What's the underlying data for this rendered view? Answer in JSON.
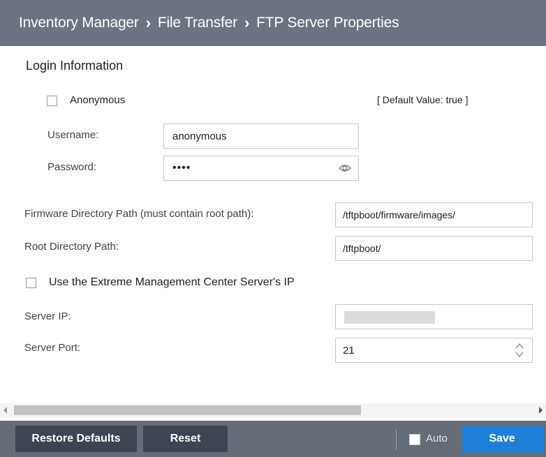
{
  "breadcrumb": [
    "Inventory Manager",
    "File Transfer",
    "FTP Server Properties"
  ],
  "section_title": "Login Information",
  "anonymous": {
    "label": "Anonymous",
    "checked": false,
    "default_note": "[ Default Value: true ]"
  },
  "username": {
    "label": "Username:",
    "value": "anonymous"
  },
  "password": {
    "label": "Password:",
    "value": "••••",
    "icon": "eye-icon"
  },
  "firmware_path": {
    "label": "Firmware Directory Path (must contain root path):",
    "value": "/tftpboot/firmware/images/"
  },
  "root_path": {
    "label": "Root Directory Path:",
    "value": "/tftpboot/"
  },
  "use_server_ip": {
    "label": "Use the Extreme Management Center Server's IP",
    "checked": false
  },
  "server_ip": {
    "label": "Server IP:",
    "value": ""
  },
  "server_port": {
    "label": "Server Port:",
    "value": "21"
  },
  "footer": {
    "restore_label": "Restore Defaults",
    "reset_label": "Reset",
    "auto_label": "Auto",
    "auto_checked": false,
    "save_label": "Save"
  },
  "colors": {
    "header_bg": "#6b7480",
    "footer_bg": "#646c77",
    "save_bg": "#1e7fd6",
    "button_dark": "#3d4552"
  }
}
